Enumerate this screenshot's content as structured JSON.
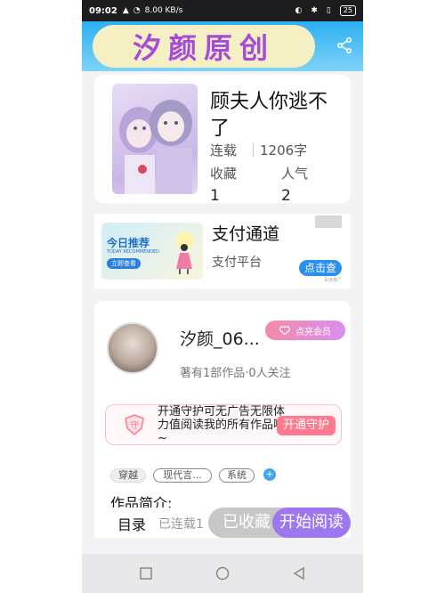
{
  "status_bar": {
    "time": "09:02",
    "network": "4G",
    "speed": "8.00 KB/s",
    "bluetooth": "✱",
    "battery": "25"
  },
  "header": {
    "brand": "汐颜原创",
    "share_icon": "share-icon"
  },
  "book": {
    "title": "顾夫人你逃不了",
    "status_label": "连载",
    "word_count": "1206字",
    "favorites_label": "收藏",
    "favorites_value": "1",
    "popularity_label": "人气",
    "popularity_value": "2"
  },
  "ad": {
    "banner_title": "今日推荐",
    "banner_sub": "TODAY RECOMMENDED",
    "banner_btn": "立即查看",
    "title": "支付通道",
    "subtitle": "支付平台",
    "button": "点击查",
    "tag": "百度推广"
  },
  "author": {
    "name": "汐颜_06...",
    "vip_label": "点亮会员",
    "stats": "著有1部作品·0人关注",
    "guard_text": "开通守护可无广告无限体力值阅读我的所有作品哟~",
    "guard_icon": "守",
    "guard_button": "开通守护",
    "tags": [
      "穿越",
      "现代言...",
      "系统"
    ],
    "intro_label": "作品简介:"
  },
  "bottom_bar": {
    "menu": "目录",
    "status": "已连载1",
    "collect": "已收藏",
    "read": "开始阅读"
  },
  "colors": {
    "header_blue": "#2cb0f2",
    "brand_purple": "#a84ad8",
    "read_purple": "#9d77f0",
    "guard_pink": "#ff7a8f"
  }
}
